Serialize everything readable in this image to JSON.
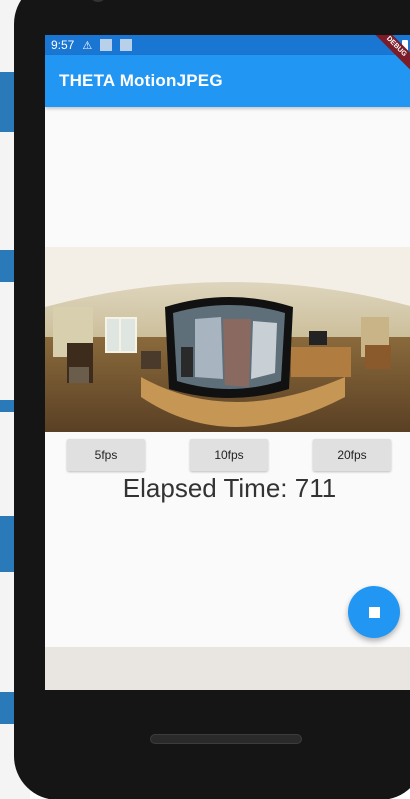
{
  "status_bar": {
    "time": "9:57",
    "icons": [
      "warning-icon",
      "notification-icon",
      "notification-icon"
    ],
    "debug_banner": "DEBUG"
  },
  "app": {
    "title": "THETA MotionJPEG",
    "accent_color": "#2196f3",
    "status_color": "#1976d2"
  },
  "fps_buttons": [
    {
      "label": "5fps"
    },
    {
      "label": "10fps"
    },
    {
      "label": "20fps"
    }
  ],
  "elapsed": {
    "text": "Elapsed Time: 711"
  },
  "fab": {
    "icon": "stop-icon"
  }
}
